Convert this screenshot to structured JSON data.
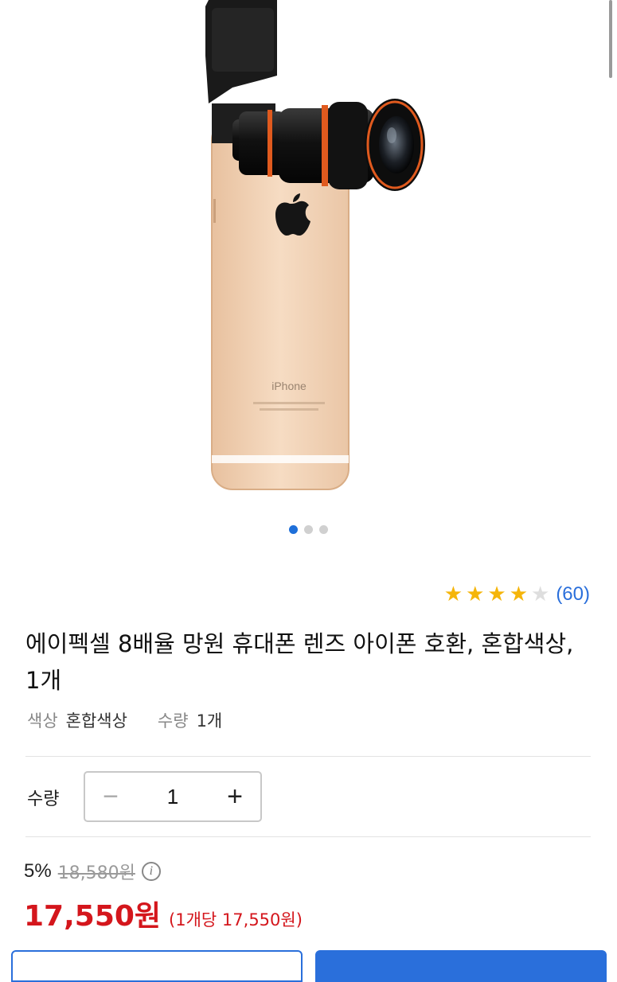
{
  "gallery": {
    "image_name": "phone-telephoto-lens-photo",
    "phone_label": "iPhone",
    "dots": [
      true,
      false,
      false
    ]
  },
  "rating": {
    "stars_filled": 4,
    "stars_total": 5,
    "review_count": "(60)",
    "star_color": "#f5b50a"
  },
  "product": {
    "title": "에이펙셀 8배율 망원 휴대폰 렌즈 아이폰 호환, 혼합색상, 1개",
    "options": [
      {
        "label": "색상",
        "value": "혼합색상"
      },
      {
        "label": "수량",
        "value": "1개"
      }
    ]
  },
  "quantity": {
    "label": "수량",
    "value": "1",
    "minus": "−",
    "plus": "+"
  },
  "price": {
    "discount_rate": "5%",
    "original_price": "18,580원",
    "sale_price": "17,550원",
    "unit_price": "(1개당 17,550원)",
    "accent_color": "#d4161c"
  },
  "colors": {
    "brand_blue": "#2a6fdb"
  }
}
